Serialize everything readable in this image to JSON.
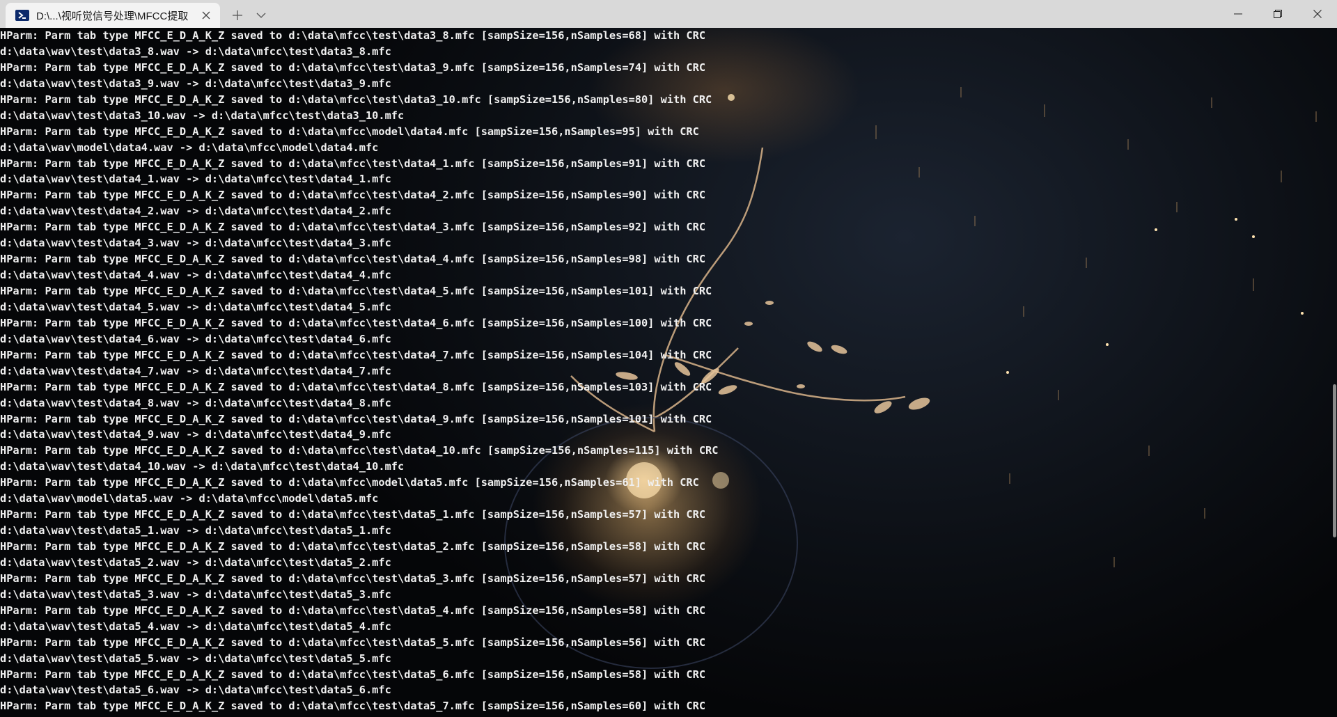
{
  "tab": {
    "title": "D:\\...\\视听觉信号处理\\MFCC提取",
    "new_tab_symbol": "+",
    "dropdown_symbol": "⌄"
  },
  "icons": {
    "tab": "powershell-icon",
    "close": "close-icon",
    "new_tab": "plus-icon",
    "dropdown": "chevron-down-icon",
    "minimize": "minimize-icon",
    "maximize": "restore-icon",
    "window_close": "close-icon"
  },
  "colors": {
    "titlebar": "#d9d9d9",
    "tab": "#f3f3f3",
    "terminal_text": "#f0f0f0",
    "terminal_bg": "#0b0e13"
  },
  "terminal": {
    "lines": [
      "HParm: Parm tab type MFCC_E_D_A_K_Z saved to d:\\data\\mfcc\\test\\data3_8.mfc [sampSize=156,nSamples=68] with CRC",
      "d:\\data\\wav\\test\\data3_8.wav -> d:\\data\\mfcc\\test\\data3_8.mfc",
      "HParm: Parm tab type MFCC_E_D_A_K_Z saved to d:\\data\\mfcc\\test\\data3_9.mfc [sampSize=156,nSamples=74] with CRC",
      "d:\\data\\wav\\test\\data3_9.wav -> d:\\data\\mfcc\\test\\data3_9.mfc",
      "HParm: Parm tab type MFCC_E_D_A_K_Z saved to d:\\data\\mfcc\\test\\data3_10.mfc [sampSize=156,nSamples=80] with CRC",
      "d:\\data\\wav\\test\\data3_10.wav -> d:\\data\\mfcc\\test\\data3_10.mfc",
      "HParm: Parm tab type MFCC_E_D_A_K_Z saved to d:\\data\\mfcc\\model\\data4.mfc [sampSize=156,nSamples=95] with CRC",
      "d:\\data\\wav\\model\\data4.wav -> d:\\data\\mfcc\\model\\data4.mfc",
      "HParm: Parm tab type MFCC_E_D_A_K_Z saved to d:\\data\\mfcc\\test\\data4_1.mfc [sampSize=156,nSamples=91] with CRC",
      "d:\\data\\wav\\test\\data4_1.wav -> d:\\data\\mfcc\\test\\data4_1.mfc",
      "HParm: Parm tab type MFCC_E_D_A_K_Z saved to d:\\data\\mfcc\\test\\data4_2.mfc [sampSize=156,nSamples=90] with CRC",
      "d:\\data\\wav\\test\\data4_2.wav -> d:\\data\\mfcc\\test\\data4_2.mfc",
      "HParm: Parm tab type MFCC_E_D_A_K_Z saved to d:\\data\\mfcc\\test\\data4_3.mfc [sampSize=156,nSamples=92] with CRC",
      "d:\\data\\wav\\test\\data4_3.wav -> d:\\data\\mfcc\\test\\data4_3.mfc",
      "HParm: Parm tab type MFCC_E_D_A_K_Z saved to d:\\data\\mfcc\\test\\data4_4.mfc [sampSize=156,nSamples=98] with CRC",
      "d:\\data\\wav\\test\\data4_4.wav -> d:\\data\\mfcc\\test\\data4_4.mfc",
      "HParm: Parm tab type MFCC_E_D_A_K_Z saved to d:\\data\\mfcc\\test\\data4_5.mfc [sampSize=156,nSamples=101] with CRC",
      "d:\\data\\wav\\test\\data4_5.wav -> d:\\data\\mfcc\\test\\data4_5.mfc",
      "HParm: Parm tab type MFCC_E_D_A_K_Z saved to d:\\data\\mfcc\\test\\data4_6.mfc [sampSize=156,nSamples=100] with CRC",
      "d:\\data\\wav\\test\\data4_6.wav -> d:\\data\\mfcc\\test\\data4_6.mfc",
      "HParm: Parm tab type MFCC_E_D_A_K_Z saved to d:\\data\\mfcc\\test\\data4_7.mfc [sampSize=156,nSamples=104] with CRC",
      "d:\\data\\wav\\test\\data4_7.wav -> d:\\data\\mfcc\\test\\data4_7.mfc",
      "HParm: Parm tab type MFCC_E_D_A_K_Z saved to d:\\data\\mfcc\\test\\data4_8.mfc [sampSize=156,nSamples=103] with CRC",
      "d:\\data\\wav\\test\\data4_8.wav -> d:\\data\\mfcc\\test\\data4_8.mfc",
      "HParm: Parm tab type MFCC_E_D_A_K_Z saved to d:\\data\\mfcc\\test\\data4_9.mfc [sampSize=156,nSamples=101] with CRC",
      "d:\\data\\wav\\test\\data4_9.wav -> d:\\data\\mfcc\\test\\data4_9.mfc",
      "HParm: Parm tab type MFCC_E_D_A_K_Z saved to d:\\data\\mfcc\\test\\data4_10.mfc [sampSize=156,nSamples=115] with CRC",
      "d:\\data\\wav\\test\\data4_10.wav -> d:\\data\\mfcc\\test\\data4_10.mfc",
      "HParm: Parm tab type MFCC_E_D_A_K_Z saved to d:\\data\\mfcc\\model\\data5.mfc [sampSize=156,nSamples=61] with CRC",
      "d:\\data\\wav\\model\\data5.wav -> d:\\data\\mfcc\\model\\data5.mfc",
      "HParm: Parm tab type MFCC_E_D_A_K_Z saved to d:\\data\\mfcc\\test\\data5_1.mfc [sampSize=156,nSamples=57] with CRC",
      "d:\\data\\wav\\test\\data5_1.wav -> d:\\data\\mfcc\\test\\data5_1.mfc",
      "HParm: Parm tab type MFCC_E_D_A_K_Z saved to d:\\data\\mfcc\\test\\data5_2.mfc [sampSize=156,nSamples=58] with CRC",
      "d:\\data\\wav\\test\\data5_2.wav -> d:\\data\\mfcc\\test\\data5_2.mfc",
      "HParm: Parm tab type MFCC_E_D_A_K_Z saved to d:\\data\\mfcc\\test\\data5_3.mfc [sampSize=156,nSamples=57] with CRC",
      "d:\\data\\wav\\test\\data5_3.wav -> d:\\data\\mfcc\\test\\data5_3.mfc",
      "HParm: Parm tab type MFCC_E_D_A_K_Z saved to d:\\data\\mfcc\\test\\data5_4.mfc [sampSize=156,nSamples=58] with CRC",
      "d:\\data\\wav\\test\\data5_4.wav -> d:\\data\\mfcc\\test\\data5_4.mfc",
      "HParm: Parm tab type MFCC_E_D_A_K_Z saved to d:\\data\\mfcc\\test\\data5_5.mfc [sampSize=156,nSamples=56] with CRC",
      "d:\\data\\wav\\test\\data5_5.wav -> d:\\data\\mfcc\\test\\data5_5.mfc",
      "HParm: Parm tab type MFCC_E_D_A_K_Z saved to d:\\data\\mfcc\\test\\data5_6.mfc [sampSize=156,nSamples=58] with CRC",
      "d:\\data\\wav\\test\\data5_6.wav -> d:\\data\\mfcc\\test\\data5_6.mfc",
      "HParm: Parm tab type MFCC_E_D_A_K_Z saved to d:\\data\\mfcc\\test\\data5_7.mfc [sampSize=156,nSamples=60] with CRC"
    ]
  }
}
